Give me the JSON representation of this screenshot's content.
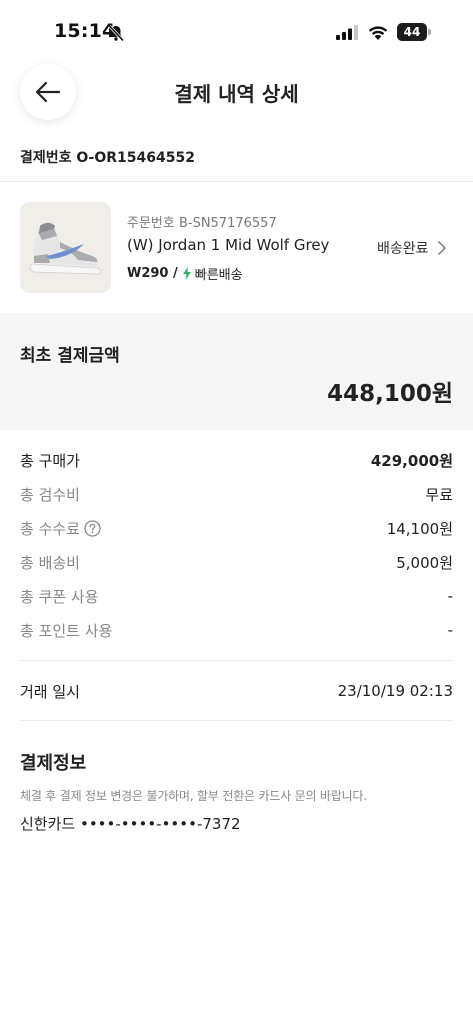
{
  "status_bar": {
    "time": "15:14",
    "battery": "44"
  },
  "header": {
    "title": "결제 내역 상세"
  },
  "payment_number": "결제번호 O-OR15464552",
  "order": {
    "order_number": "주문번호 B-SN57176557",
    "product_name": "(W) Jordan 1 Mid Wolf Grey",
    "size": "W290 /",
    "shipping_type": "빠른배송",
    "status": "배송완료"
  },
  "initial_payment": {
    "label": "최초 결제금액",
    "amount": "448,100원"
  },
  "breakdown": [
    {
      "label": "총 구매가",
      "value": "429,000원"
    },
    {
      "label": "총 검수비",
      "value": "무료"
    },
    {
      "label": "총 수수료",
      "value": "14,100원"
    },
    {
      "label": "총 배송비",
      "value": "5,000원"
    },
    {
      "label": "총 쿠폰 사용",
      "value": "-"
    },
    {
      "label": "총 포인트 사용",
      "value": "-"
    }
  ],
  "transaction": {
    "label": "거래 일시",
    "value": "23/10/19 02:13"
  },
  "payment_info": {
    "title": "결제정보",
    "notice": "체결 후 결제 정보 변경은 불가하며, 할부 전환은 카드사 문의 바랍니다.",
    "card": "신한카드 ••••-••••-••••-7372"
  },
  "colors": {
    "accent_green": "#31b46e",
    "section_bg": "#f6f6f6",
    "muted_text": "#888888"
  }
}
